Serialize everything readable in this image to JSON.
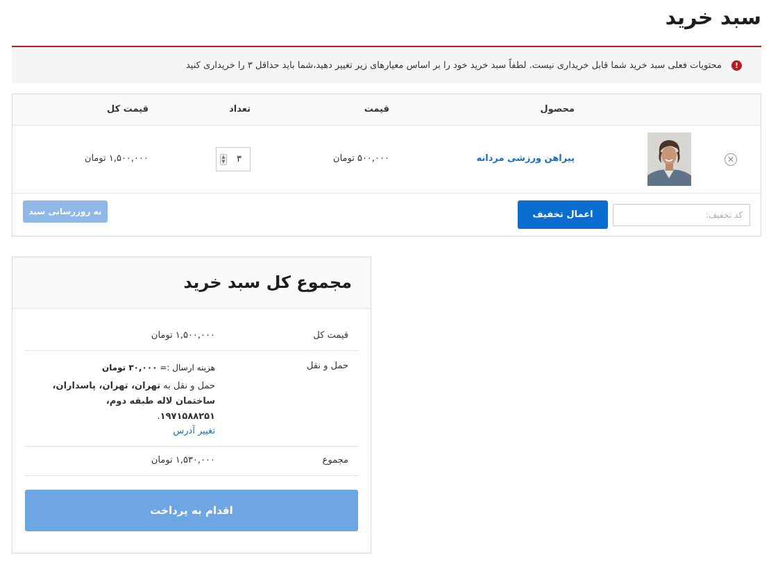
{
  "page": {
    "title": "سبد خرید"
  },
  "notice": {
    "icon": "exclamation-icon",
    "text": "محتویات فعلی سبد خرید شما قابل خریداری نیست. لطفاً سبد خرید خود را بر اساس معیارهای زیر تغییر دهید،شما باید حداقل ۳ را خریداری کنید"
  },
  "cart": {
    "headers": {
      "product": "محصول",
      "price": "قیمت",
      "quantity": "تعداد",
      "subtotal": "قیمت کل"
    },
    "items": [
      {
        "name": "پیراهن ورزشی مردانه",
        "price": "۵۰۰,۰۰۰ تومان",
        "quantity": "۳",
        "subtotal": "۱,۵۰۰,۰۰۰ تومان",
        "remove_icon": "close-circle-icon",
        "thumbnail": "product-photo"
      }
    ],
    "coupon_placeholder": "کد تخفیف:",
    "apply_coupon_label": "اعمال تخفیف",
    "update_cart_label": "به روزرسانی سبد"
  },
  "totals": {
    "title": "مجموع کل سبد خرید",
    "subtotal_label": "قیمت کل",
    "subtotal_value": "۱,۵۰۰,۰۰۰ تومان",
    "shipping_label": "حمل و نقل",
    "shipping_method_label": "هزینه ارسال :=",
    "shipping_method_value": "۳۰,۰۰۰ تومان",
    "shipping_dest_prefix": "حمل و نقل به",
    "shipping_dest_address": "تهران، تهران، پاسداران، ساختمان لاله طبقه دوم، ۱۹۷۱۵۸۸۲۵۱",
    "shipping_dest_suffix": ".",
    "change_address_label": "تغییر آدرس",
    "total_label": "مجموع",
    "total_value": "۱,۵۳۰,۰۰۰ تومان",
    "checkout_label": "اقدام به پرداخت"
  },
  "colors": {
    "accent": "#0a6ed1",
    "error": "#b81c23",
    "link": "#1a6ec2",
    "checkout_disabled": "#6ea6e3"
  }
}
